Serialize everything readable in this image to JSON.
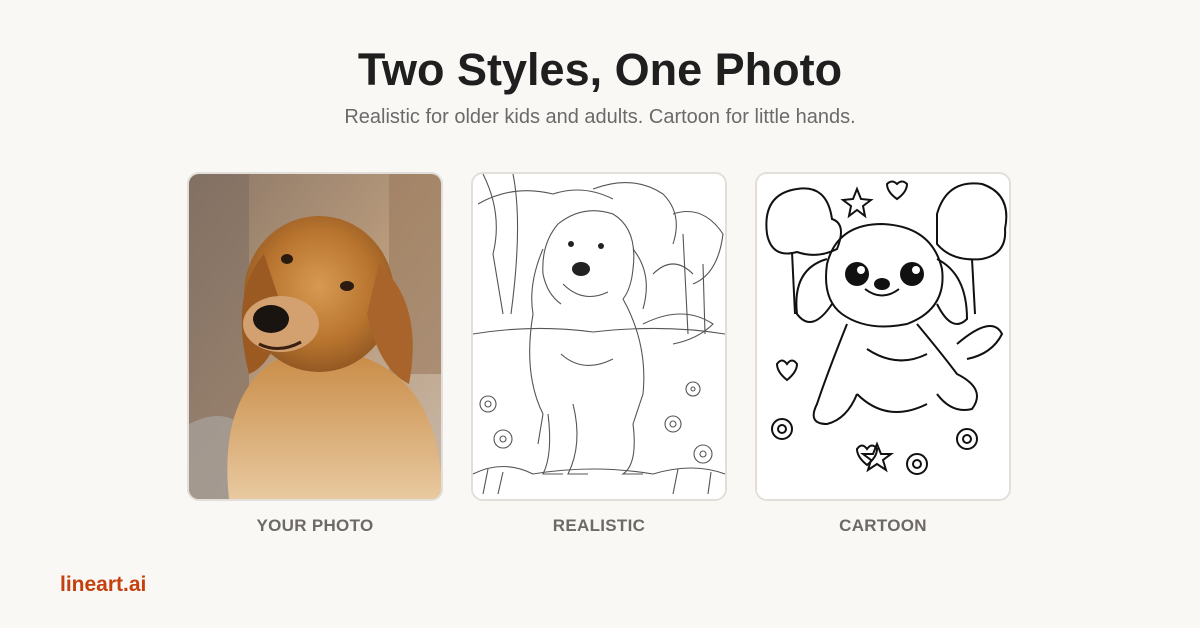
{
  "header": {
    "title": "Two Styles, One Photo",
    "subtitle": "Realistic for older kids and adults. Cartoon for little hands."
  },
  "cards": [
    {
      "caption": "YOUR PHOTO",
      "image": "golden-retriever-photo"
    },
    {
      "caption": "REALISTIC",
      "image": "realistic-line-art"
    },
    {
      "caption": "CARTOON",
      "image": "cartoon-line-art"
    }
  ],
  "footer": {
    "brand": "lineart.ai",
    "brand_color": "#c4400e"
  }
}
